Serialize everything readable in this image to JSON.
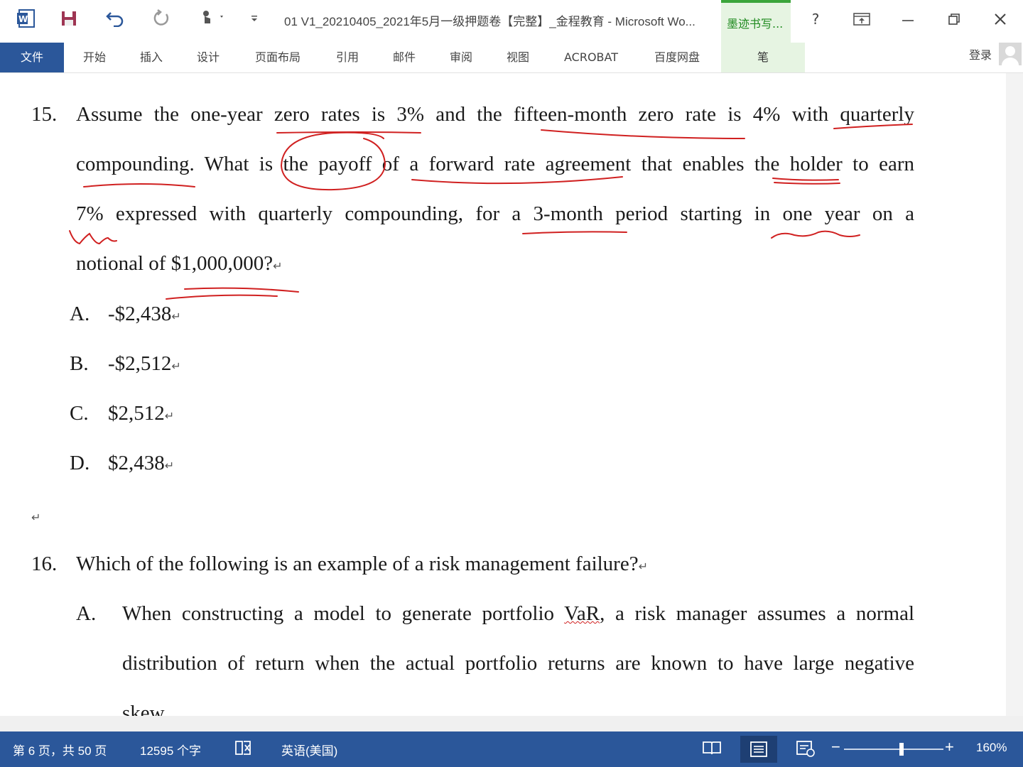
{
  "window": {
    "title": "01 V1_20210405_2021年5月一级押题卷【完整】_金程教育 - Microsoft Wo...",
    "ink_tab": "墨迹书写...",
    "help": "?"
  },
  "ribbon": {
    "tabs": [
      "文件",
      "开始",
      "插入",
      "设计",
      "页面布局",
      "引用",
      "邮件",
      "审阅",
      "视图",
      "ACROBAT",
      "百度网盘",
      "笔"
    ],
    "login": "登录"
  },
  "document": {
    "q15": {
      "number": "15.",
      "lines": [
        "Assume the one-year zero rates is 3% and the fifteen-month zero rate is 4% with quarterly",
        "compounding. What is the payoff of a forward rate agreement that enables the holder to earn",
        "7% expressed with quarterly compounding, for a 3-month period starting in one year on a",
        "notional of $1,000,000?"
      ],
      "options": [
        {
          "letter": "A.",
          "text": "-$2,438"
        },
        {
          "letter": "B.",
          "text": "-$2,512"
        },
        {
          "letter": "C.",
          "text": "$2,512"
        },
        {
          "letter": "D.",
          "text": "$2,438"
        }
      ]
    },
    "paragraph_mark": "↵",
    "q16": {
      "number": "16.",
      "question": "Which of the following is an example of a risk management failure?",
      "option_a_letter": "A.",
      "option_a_line1_before": "When constructing a model to generate portfolio ",
      "option_a_line1_var": "VaR",
      "option_a_line1_after": ", a risk manager assumes a normal",
      "option_a_line2": "distribution of return when the actual portfolio returns are known to have large negative",
      "option_a_line3": "skew."
    }
  },
  "status": {
    "page": "第 6 页，共 50 页",
    "words": "12595 个字",
    "language": "英语(美国)",
    "zoom": "160%",
    "zoom_level_percent": 160
  },
  "colors": {
    "accent": "#2b579a",
    "ink_red": "#d02020",
    "ink_tab_green": "#3ba53b"
  }
}
